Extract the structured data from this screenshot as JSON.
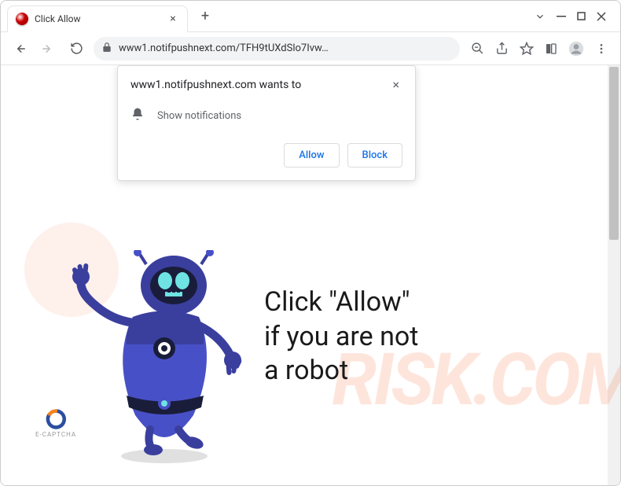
{
  "tab": {
    "title": "Click Allow"
  },
  "url": "www1.notifpushnext.com/TFH9tUXdSlo7Ivw…",
  "permission": {
    "origin": "www1.notifpushnext.com wants to",
    "body": "Show notifications",
    "allow": "Allow",
    "block": "Block"
  },
  "message": {
    "l1": "Click \"Allow\"",
    "l2": "if you are not",
    "l3": "a robot"
  },
  "ecaptcha": "E-CAPTCHA",
  "watermark": "RISK.COM"
}
